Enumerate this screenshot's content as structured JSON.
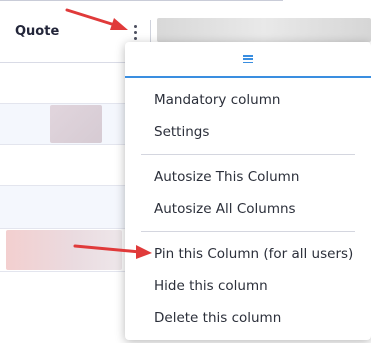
{
  "column": {
    "title": "Quote"
  },
  "menu": {
    "groups": [
      [
        "Mandatory column",
        "Settings"
      ],
      [
        "Autosize This Column",
        "Autosize All Columns"
      ],
      [
        "Pin this Column (for all users)",
        "Hide this column",
        "Delete this column"
      ]
    ]
  },
  "colors": {
    "accent": "#3a8ee0",
    "arrow": "#e03a3a"
  },
  "icons": {
    "trigger": "vertical-ellipsis-icon",
    "menu_tab": "hamburger-menu-icon"
  }
}
